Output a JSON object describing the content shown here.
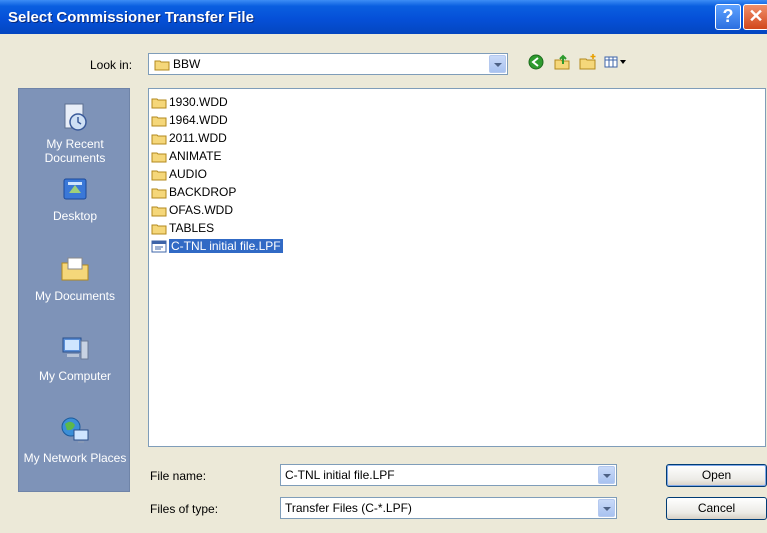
{
  "window": {
    "title": "Select Commissioner Transfer File"
  },
  "titlebar": {
    "help_glyph": "?",
    "close_glyph": "✕"
  },
  "lookin": {
    "label": "Look in:",
    "value": "BBW"
  },
  "toolbar": {
    "icons": [
      "back-icon",
      "up-folder-icon",
      "new-folder-icon",
      "views-menu-icon"
    ]
  },
  "places": [
    {
      "label": "My Recent Documents",
      "icon": "recent-documents-icon"
    },
    {
      "label": "Desktop",
      "icon": "desktop-icon"
    },
    {
      "label": "My Documents",
      "icon": "my-documents-icon"
    },
    {
      "label": "My Computer",
      "icon": "my-computer-icon"
    },
    {
      "label": "My Network Places",
      "icon": "network-places-icon"
    }
  ],
  "files": [
    {
      "name": "1930.WDD",
      "type": "folder"
    },
    {
      "name": "1964.WDD",
      "type": "folder"
    },
    {
      "name": "2011.WDD",
      "type": "folder"
    },
    {
      "name": "ANIMATE",
      "type": "folder"
    },
    {
      "name": "AUDIO",
      "type": "folder"
    },
    {
      "name": "BACKDROP",
      "type": "folder"
    },
    {
      "name": "OFAS.WDD",
      "type": "folder"
    },
    {
      "name": "TABLES",
      "type": "folder"
    },
    {
      "name": "C-TNL initial file.LPF",
      "type": "file",
      "selected": true
    }
  ],
  "filename": {
    "label": "File name:",
    "value": "C-TNL initial file.LPF"
  },
  "filetype": {
    "label": "Files of type:",
    "value": "Transfer Files (C-*.LPF)"
  },
  "buttons": {
    "open": "Open",
    "cancel": "Cancel"
  },
  "colors": {
    "title_bar": "#0550D8",
    "places_bar": "#7E93B8",
    "selection": "#316AC5",
    "window_bg": "#ECE9D8"
  }
}
